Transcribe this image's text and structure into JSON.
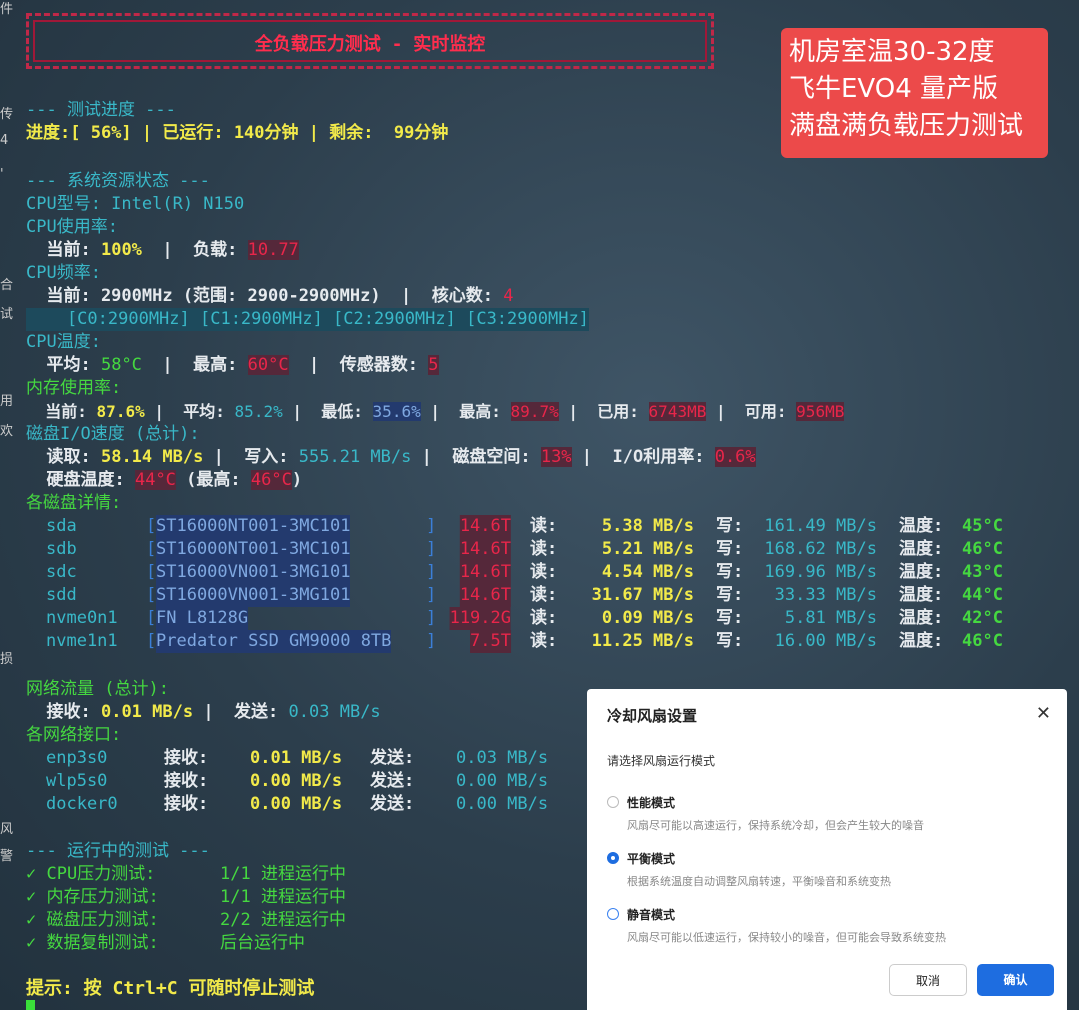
{
  "title_banner": "全负载压力测试 - 实时监控",
  "note": {
    "line1": "机房室温30-32度",
    "line2": "飞牛EVO4 量产版",
    "line3": "满盘满负载压力测试"
  },
  "progress": {
    "header": "--- 测试进度 ---",
    "line": "进度:[ 56%] | 已运行: 140分钟 | 剩余:  99分钟"
  },
  "system": {
    "header": "--- 系统资源状态 ---",
    "cpu_model": "CPU型号: Intel(R) N150",
    "cpu_usage_label": "CPU使用率:",
    "cpu_current_label": "  当前:",
    "cpu_current_value": "100%",
    "cpu_load_label": "|  负载:",
    "cpu_load_value": "10.77",
    "cpu_freq_label": "CPU频率:",
    "cpu_freq_current": "  当前: 2900MHz (范围: 2900-2900MHz)  |  核心数:",
    "cpu_cores": "4",
    "cpu_cores_list": "    [C0:2900MHz] [C1:2900MHz] [C2:2900MHz] [C3:2900MHz]",
    "cpu_temp_label": "CPU温度:",
    "cpu_temp_avg_label": "  平均:",
    "cpu_temp_avg": "58°C",
    "cpu_temp_max_label": "|  最高:",
    "cpu_temp_max": "60°C",
    "cpu_sensors_label": "|  传感器数:",
    "cpu_sensors": "5",
    "mem_label": "内存使用率:",
    "mem_current_label": "  当前:",
    "mem_current": "87.6%",
    "mem_avg_label": "|  平均:",
    "mem_avg": "85.2%",
    "mem_min_label": "|  最低:",
    "mem_min": "35.6%",
    "mem_max_label": "|  最高:",
    "mem_max": "89.7%",
    "mem_used_label": "|  已用:",
    "mem_used": "6743MB",
    "mem_free_label": "|  可用:",
    "mem_free": "956MB",
    "disk_io_label": "磁盘I/O速度 (总计):",
    "disk_read_label": "  读取:",
    "disk_read": "58.14 MB/s",
    "disk_write_label": "|  写入:",
    "disk_write": "555.21 MB/s",
    "disk_space_label": "|  磁盘空间:",
    "disk_space": "13%",
    "io_util_label": "|  I/O利用率:",
    "io_util": "0.6%",
    "disk_temp_label": "  硬盘温度:",
    "disk_temp": "44°C",
    "disk_temp_max_label": " (最高:",
    "disk_temp_max": "46°C",
    "disk_temp_close": ")",
    "disk_details_label": "各磁盘详情:"
  },
  "disks": [
    {
      "name": "sda",
      "model": "ST16000NT001-3MC101",
      "size": "14.6T",
      "read": "5.38 MB/s",
      "write": "161.49 MB/s",
      "temp": "45°C"
    },
    {
      "name": "sdb",
      "model": "ST16000NT001-3MC101",
      "size": "14.6T",
      "read": "5.21 MB/s",
      "write": "168.62 MB/s",
      "temp": "46°C"
    },
    {
      "name": "sdc",
      "model": "ST16000VN001-3MG101",
      "size": "14.6T",
      "read": "4.54 MB/s",
      "write": "169.96 MB/s",
      "temp": "43°C"
    },
    {
      "name": "sdd",
      "model": "ST16000VN001-3MG101",
      "size": "14.6T",
      "read": "31.67 MB/s",
      "write": "33.33 MB/s",
      "temp": "44°C"
    },
    {
      "name": "nvme0n1",
      "model": "FN L8128G",
      "size": "119.2G",
      "read": "0.09 MB/s",
      "write": "5.81 MB/s",
      "temp": "42°C"
    },
    {
      "name": "nvme1n1",
      "model": "Predator SSD GM9000 8TB",
      "size": "7.5T",
      "read": "11.25 MB/s",
      "write": "16.00 MB/s",
      "temp": "46°C"
    }
  ],
  "disk_labels": {
    "read": "读:",
    "write": "写:",
    "temp": "温度:"
  },
  "network": {
    "total_label": "网络流量 (总计):",
    "rx_label": "  接收:",
    "rx": "0.01 MB/s",
    "tx_label": "|  发送:",
    "tx": "0.03 MB/s",
    "ifaces_label": "各网络接口:",
    "rx_word": "接收:",
    "tx_word": "发送:",
    "ifaces": [
      {
        "name": "enp3s0",
        "rx": "0.01 MB/s",
        "tx": "0.03 MB/s"
      },
      {
        "name": "wlp5s0",
        "rx": "0.00 MB/s",
        "tx": "0.00 MB/s"
      },
      {
        "name": "docker0",
        "rx": "0.00 MB/s",
        "tx": "0.00 MB/s"
      }
    ]
  },
  "tests": {
    "header": "--- 运行中的测试 ---",
    "items": [
      {
        "name": "✓ CPU压力测试:",
        "status": "1/1 进程运行中"
      },
      {
        "name": "✓ 内存压力测试:",
        "status": "1/1 进程运行中"
      },
      {
        "name": "✓ 磁盘压力测试:",
        "status": "2/2 进程运行中"
      },
      {
        "name": "✓ 数据复制测试:",
        "status": "后台运行中"
      }
    ]
  },
  "hint": "提示: 按 Ctrl+C 可随时停止测试",
  "side_chars": [
    "件",
    "传",
    "4",
    "'",
    "合",
    "试",
    "用",
    "欢",
    "损",
    "风",
    "警"
  ],
  "dialog": {
    "title": "冷却风扇设置",
    "prompt": "请选择风扇运行模式",
    "options": [
      {
        "label": "性能模式",
        "desc": "风扇尽可能以高速运行，保持系统冷却，但会产生较大的噪音"
      },
      {
        "label": "平衡模式",
        "desc": "根据系统温度自动调整风扇转速，平衡噪音和系统变热"
      },
      {
        "label": "静音模式",
        "desc": "风扇尽可能以低速运行，保持较小的噪音，但可能会导致系统变热"
      }
    ],
    "cancel": "取消",
    "confirm": "确认",
    "selected": "平衡模式"
  }
}
